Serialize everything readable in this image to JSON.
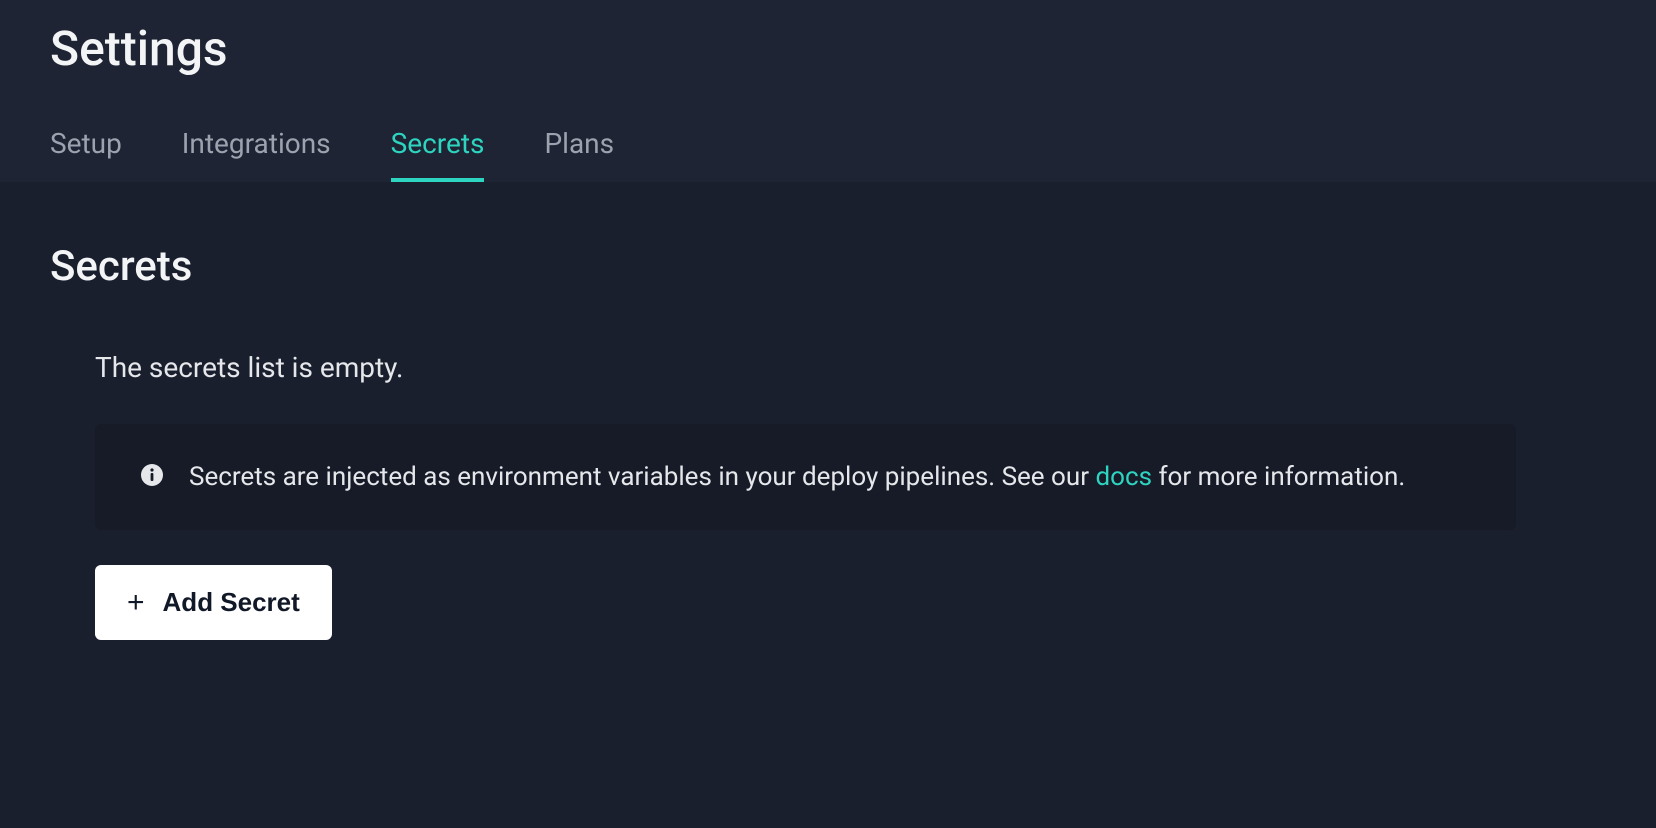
{
  "header": {
    "title": "Settings"
  },
  "tabs": [
    {
      "label": "Setup",
      "active": false
    },
    {
      "label": "Integrations",
      "active": false
    },
    {
      "label": "Secrets",
      "active": true
    },
    {
      "label": "Plans",
      "active": false
    }
  ],
  "section": {
    "title": "Secrets",
    "empty_message": "The secrets list is empty.",
    "info_text_before": "Secrets are injected as environment variables in your deploy pipelines. See our ",
    "info_link_text": "docs",
    "info_text_after": " for more information.",
    "add_button_label": "Add Secret"
  }
}
